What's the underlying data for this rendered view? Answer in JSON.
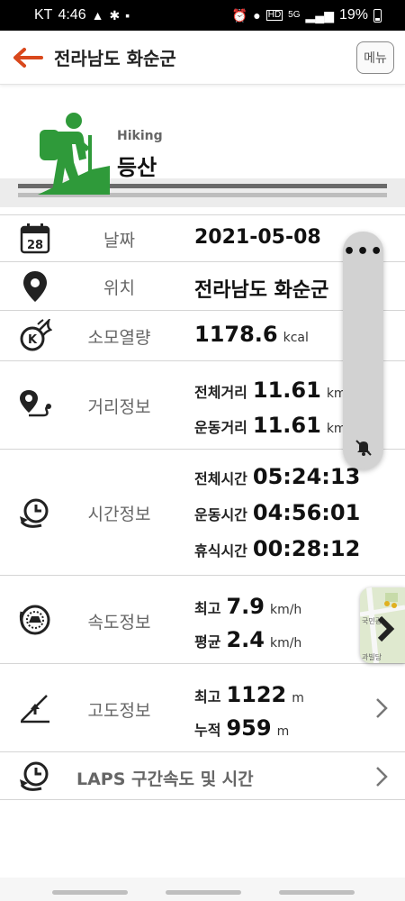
{
  "status_bar": {
    "carrier": "KT",
    "time": "4:46",
    "network": "5G",
    "battery": "19%"
  },
  "app_bar": {
    "title": "전라남도 화순군",
    "menu_label": "메뉴"
  },
  "activity": {
    "name_en": "Hiking",
    "name_ko": "등산",
    "accent_color": "#2f9a3a"
  },
  "date": {
    "label": "날짜",
    "value": "2021-05-08",
    "calendar_day": "28"
  },
  "location": {
    "label": "위치",
    "value": "전라남도 화순군"
  },
  "calories": {
    "label": "소모열량",
    "value": "1178.6",
    "unit": "kcal"
  },
  "distance": {
    "label": "거리정보",
    "total_label": "전체거리",
    "total_value": "11.61",
    "total_unit": "km",
    "moving_label": "운동거리",
    "moving_value": "11.61",
    "moving_unit": "km"
  },
  "time_info": {
    "label": "시간정보",
    "total_label": "전체시간",
    "total_value": "05:24:13",
    "moving_label": "운동시간",
    "moving_value": "04:56:01",
    "rest_label": "휴식시간",
    "rest_value": "00:28:12"
  },
  "speed": {
    "label": "속도정보",
    "max_label": "최고",
    "max_value": "7.9",
    "max_unit": "km/h",
    "avg_label": "평균",
    "avg_value": "2.4",
    "avg_unit": "km/h"
  },
  "altitude": {
    "label": "고도정보",
    "max_label": "최고",
    "max_value": "1122",
    "max_unit": "m",
    "cumulative_label": "누적",
    "cumulative_value": "959",
    "cumulative_unit": "m"
  },
  "laps": {
    "label": "LAPS 구간속도 및 시간"
  },
  "side_panel": {
    "more_label": "•••"
  },
  "map_thumbnail": {
    "text_1": "국민광",
    "text_2": "과빌당"
  }
}
